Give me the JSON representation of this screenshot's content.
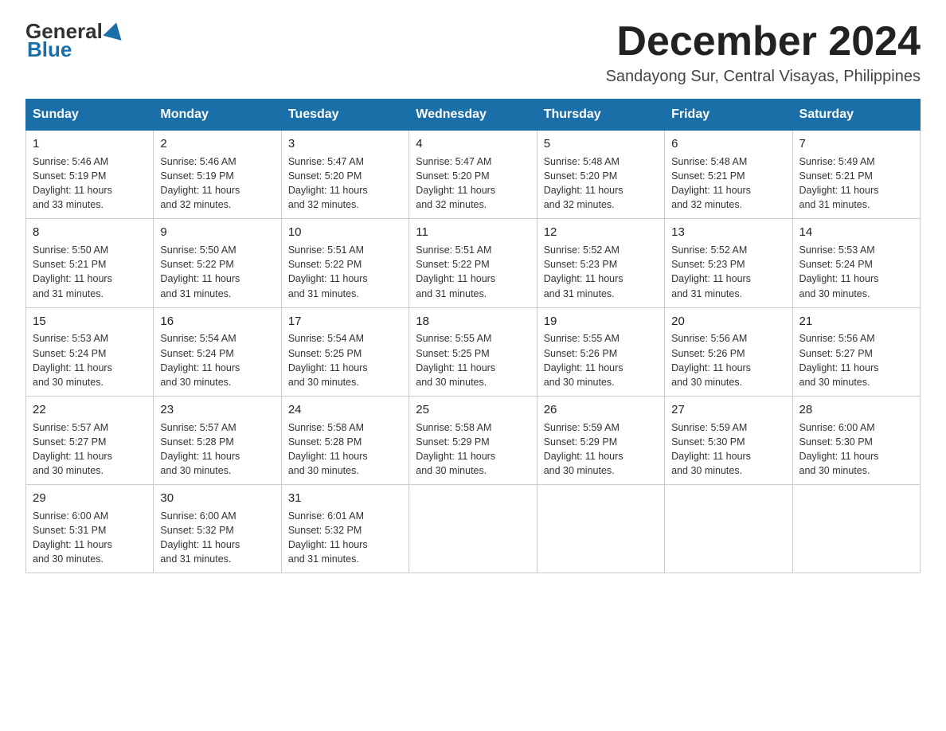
{
  "header": {
    "logo": {
      "general": "General",
      "blue": "Blue",
      "underline": "Blue"
    },
    "title": "December 2024",
    "subtitle": "Sandayong Sur, Central Visayas, Philippines"
  },
  "calendar": {
    "days_of_week": [
      "Sunday",
      "Monday",
      "Tuesday",
      "Wednesday",
      "Thursday",
      "Friday",
      "Saturday"
    ],
    "weeks": [
      [
        {
          "day": "1",
          "sunrise": "5:46 AM",
          "sunset": "5:19 PM",
          "daylight": "11 hours and 33 minutes."
        },
        {
          "day": "2",
          "sunrise": "5:46 AM",
          "sunset": "5:19 PM",
          "daylight": "11 hours and 32 minutes."
        },
        {
          "day": "3",
          "sunrise": "5:47 AM",
          "sunset": "5:20 PM",
          "daylight": "11 hours and 32 minutes."
        },
        {
          "day": "4",
          "sunrise": "5:47 AM",
          "sunset": "5:20 PM",
          "daylight": "11 hours and 32 minutes."
        },
        {
          "day": "5",
          "sunrise": "5:48 AM",
          "sunset": "5:20 PM",
          "daylight": "11 hours and 32 minutes."
        },
        {
          "day": "6",
          "sunrise": "5:48 AM",
          "sunset": "5:21 PM",
          "daylight": "11 hours and 32 minutes."
        },
        {
          "day": "7",
          "sunrise": "5:49 AM",
          "sunset": "5:21 PM",
          "daylight": "11 hours and 31 minutes."
        }
      ],
      [
        {
          "day": "8",
          "sunrise": "5:50 AM",
          "sunset": "5:21 PM",
          "daylight": "11 hours and 31 minutes."
        },
        {
          "day": "9",
          "sunrise": "5:50 AM",
          "sunset": "5:22 PM",
          "daylight": "11 hours and 31 minutes."
        },
        {
          "day": "10",
          "sunrise": "5:51 AM",
          "sunset": "5:22 PM",
          "daylight": "11 hours and 31 minutes."
        },
        {
          "day": "11",
          "sunrise": "5:51 AM",
          "sunset": "5:22 PM",
          "daylight": "11 hours and 31 minutes."
        },
        {
          "day": "12",
          "sunrise": "5:52 AM",
          "sunset": "5:23 PM",
          "daylight": "11 hours and 31 minutes."
        },
        {
          "day": "13",
          "sunrise": "5:52 AM",
          "sunset": "5:23 PM",
          "daylight": "11 hours and 31 minutes."
        },
        {
          "day": "14",
          "sunrise": "5:53 AM",
          "sunset": "5:24 PM",
          "daylight": "11 hours and 30 minutes."
        }
      ],
      [
        {
          "day": "15",
          "sunrise": "5:53 AM",
          "sunset": "5:24 PM",
          "daylight": "11 hours and 30 minutes."
        },
        {
          "day": "16",
          "sunrise": "5:54 AM",
          "sunset": "5:24 PM",
          "daylight": "11 hours and 30 minutes."
        },
        {
          "day": "17",
          "sunrise": "5:54 AM",
          "sunset": "5:25 PM",
          "daylight": "11 hours and 30 minutes."
        },
        {
          "day": "18",
          "sunrise": "5:55 AM",
          "sunset": "5:25 PM",
          "daylight": "11 hours and 30 minutes."
        },
        {
          "day": "19",
          "sunrise": "5:55 AM",
          "sunset": "5:26 PM",
          "daylight": "11 hours and 30 minutes."
        },
        {
          "day": "20",
          "sunrise": "5:56 AM",
          "sunset": "5:26 PM",
          "daylight": "11 hours and 30 minutes."
        },
        {
          "day": "21",
          "sunrise": "5:56 AM",
          "sunset": "5:27 PM",
          "daylight": "11 hours and 30 minutes."
        }
      ],
      [
        {
          "day": "22",
          "sunrise": "5:57 AM",
          "sunset": "5:27 PM",
          "daylight": "11 hours and 30 minutes."
        },
        {
          "day": "23",
          "sunrise": "5:57 AM",
          "sunset": "5:28 PM",
          "daylight": "11 hours and 30 minutes."
        },
        {
          "day": "24",
          "sunrise": "5:58 AM",
          "sunset": "5:28 PM",
          "daylight": "11 hours and 30 minutes."
        },
        {
          "day": "25",
          "sunrise": "5:58 AM",
          "sunset": "5:29 PM",
          "daylight": "11 hours and 30 minutes."
        },
        {
          "day": "26",
          "sunrise": "5:59 AM",
          "sunset": "5:29 PM",
          "daylight": "11 hours and 30 minutes."
        },
        {
          "day": "27",
          "sunrise": "5:59 AM",
          "sunset": "5:30 PM",
          "daylight": "11 hours and 30 minutes."
        },
        {
          "day": "28",
          "sunrise": "6:00 AM",
          "sunset": "5:30 PM",
          "daylight": "11 hours and 30 minutes."
        }
      ],
      [
        {
          "day": "29",
          "sunrise": "6:00 AM",
          "sunset": "5:31 PM",
          "daylight": "11 hours and 30 minutes."
        },
        {
          "day": "30",
          "sunrise": "6:00 AM",
          "sunset": "5:32 PM",
          "daylight": "11 hours and 31 minutes."
        },
        {
          "day": "31",
          "sunrise": "6:01 AM",
          "sunset": "5:32 PM",
          "daylight": "11 hours and 31 minutes."
        },
        null,
        null,
        null,
        null
      ]
    ],
    "labels": {
      "sunrise": "Sunrise:",
      "sunset": "Sunset:",
      "daylight": "Daylight:"
    }
  }
}
